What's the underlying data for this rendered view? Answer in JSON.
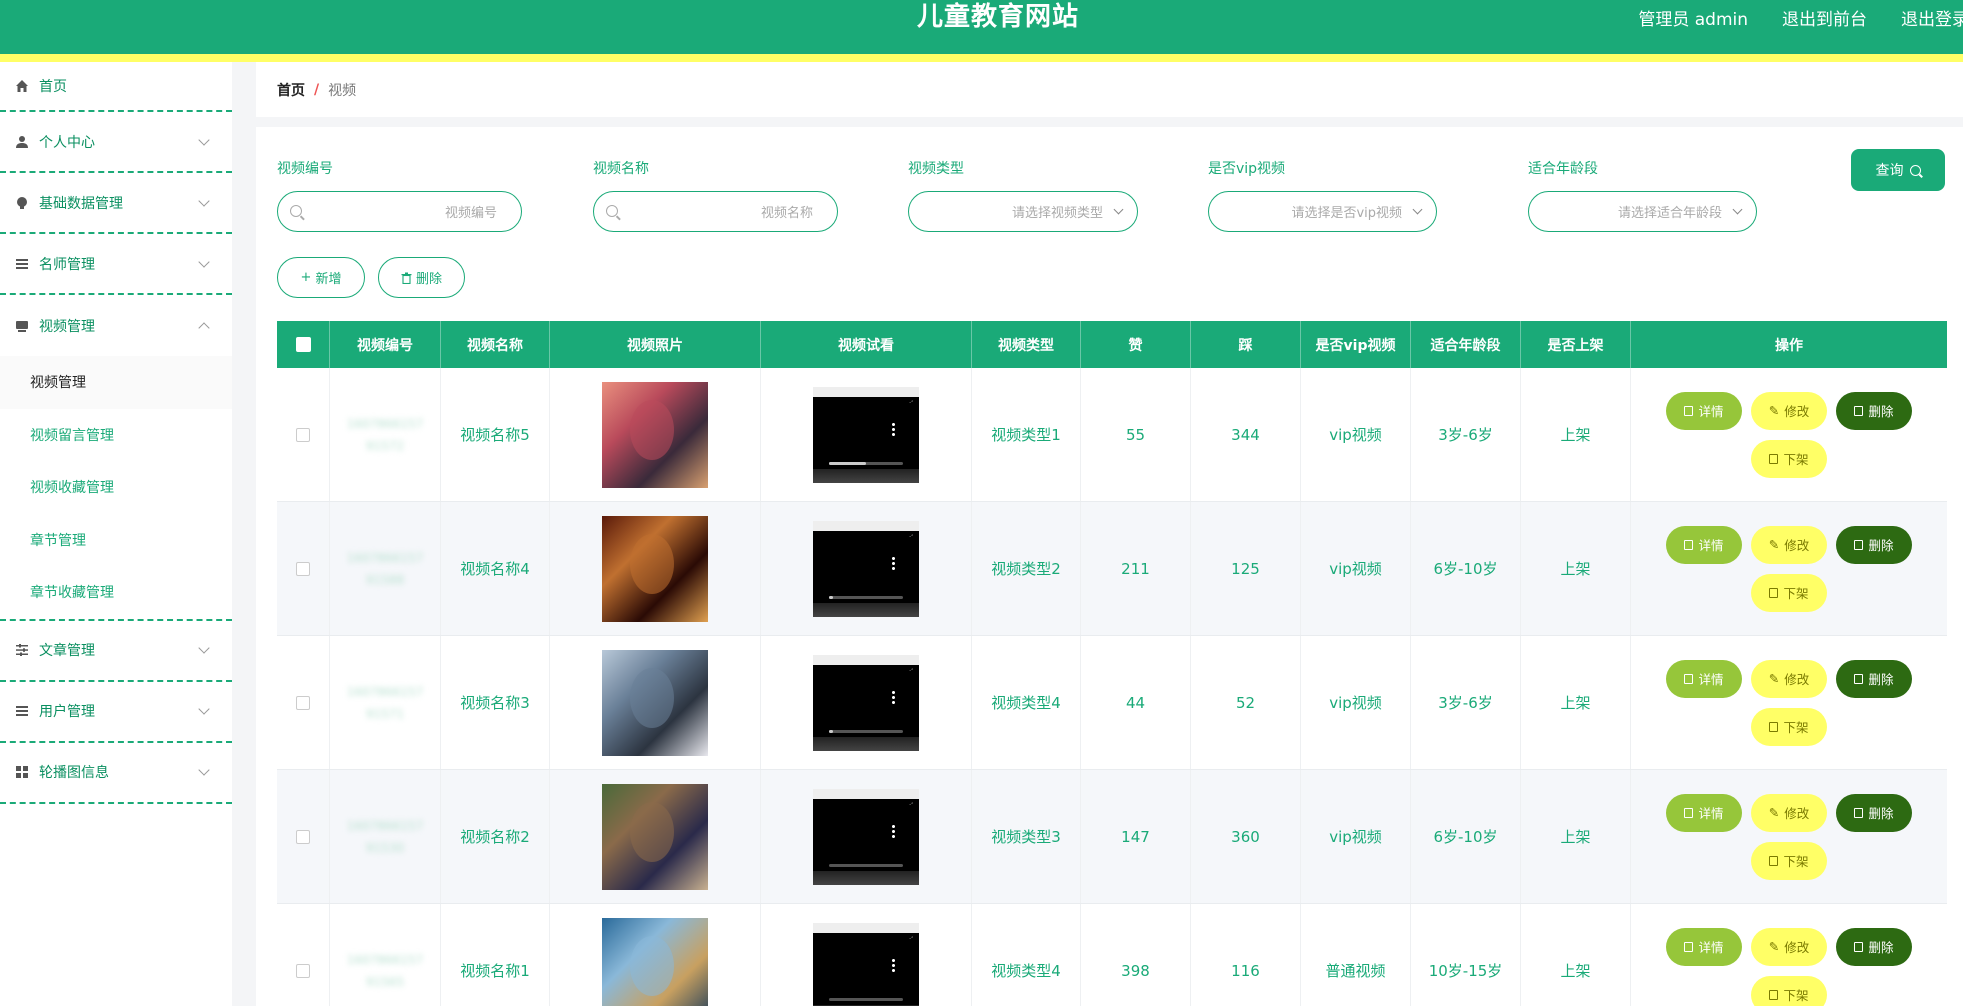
{
  "header": {
    "site_title": "儿童教育网站",
    "admin_label": "管理员 admin",
    "front_link": "退出到前台",
    "logout_link": "退出登录"
  },
  "sidebar": {
    "home": "首页",
    "items": [
      {
        "label": "个人中心",
        "icon": "user-icon"
      },
      {
        "label": "基础数据管理",
        "icon": "bulb-icon"
      },
      {
        "label": "名师管理",
        "icon": "list-icon"
      },
      {
        "label": "视频管理",
        "icon": "video-icon",
        "expanded": true
      },
      {
        "label": "文章管理",
        "icon": "sliders-icon"
      },
      {
        "label": "用户管理",
        "icon": "menu-icon"
      },
      {
        "label": "轮播图信息",
        "icon": "grid-icon"
      }
    ],
    "submenu": [
      "视频管理",
      "视频留言管理",
      "视频收藏管理",
      "章节管理",
      "章节收藏管理"
    ]
  },
  "breadcrumb": {
    "home": "首页",
    "sep": "/",
    "current": "视频"
  },
  "filters": {
    "code": {
      "label": "视频编号",
      "placeholder": "视频编号"
    },
    "name": {
      "label": "视频名称",
      "placeholder": "视频名称"
    },
    "type": {
      "label": "视频类型",
      "placeholder": "请选择视频类型"
    },
    "vip": {
      "label": "是否vip视频",
      "placeholder": "请选择是否vip视频"
    },
    "age": {
      "label": "适合年龄段",
      "placeholder": "请选择适合年龄段"
    }
  },
  "buttons": {
    "query": "查询",
    "add": "新增",
    "delete": "删除"
  },
  "table": {
    "columns": [
      "视频编号",
      "视频名称",
      "视频照片",
      "视频试看",
      "视频类型",
      "赞",
      "踩",
      "是否vip视频",
      "适合年龄段",
      "是否上架",
      "操作"
    ],
    "op_labels": {
      "detail": "详情",
      "edit": "修改",
      "delete": "删除",
      "off": "下架"
    },
    "rows": [
      {
        "code": "1607866157 91572",
        "name": "视频名称5",
        "type": "视频类型1",
        "likes": "55",
        "dislikes": "344",
        "vip": "vip视频",
        "age": "3岁-6岁",
        "status": "上架",
        "progress": 0.5
      },
      {
        "code": "1607866157 91588",
        "name": "视频名称4",
        "type": "视频类型2",
        "likes": "211",
        "dislikes": "125",
        "vip": "vip视频",
        "age": "6岁-10岁",
        "status": "上架",
        "progress": 0.05
      },
      {
        "code": "1607866157 91571",
        "name": "视频名称3",
        "type": "视频类型4",
        "likes": "44",
        "dislikes": "52",
        "vip": "vip视频",
        "age": "3岁-6岁",
        "status": "上架",
        "progress": 0.05
      },
      {
        "code": "1607866157 91530",
        "name": "视频名称2",
        "type": "视频类型3",
        "likes": "147",
        "dislikes": "360",
        "vip": "vip视频",
        "age": "6岁-10岁",
        "status": "上架",
        "progress": 0
      },
      {
        "code": "1607866157 91565",
        "name": "视频名称1",
        "type": "视频类型4",
        "likes": "398",
        "dislikes": "116",
        "vip": "普通视频",
        "age": "10岁-15岁",
        "status": "上架",
        "progress": 0
      }
    ]
  },
  "colors": {
    "primary": "#1aaa78",
    "accent_yellow": "#ffff66",
    "detail_green": "#96c63a",
    "delete_dark": "#2d6a12"
  }
}
